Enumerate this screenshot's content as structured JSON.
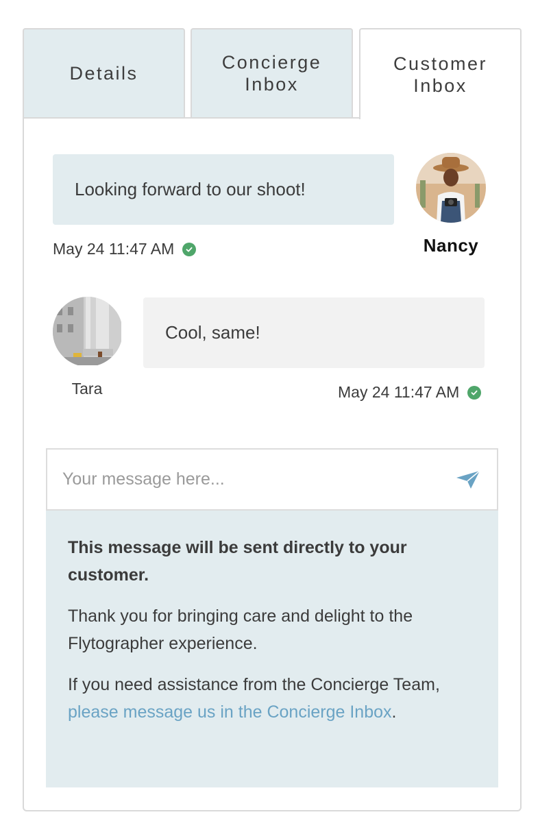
{
  "tabs": {
    "details": "Details",
    "concierge": "Concierge\nInbox",
    "customer": "Customer\nInbox",
    "active": "customer"
  },
  "messages": [
    {
      "sender": "Nancy",
      "text": "Looking forward to our shoot!",
      "timestamp": "May 24 11:47 AM",
      "status_icon": "check-circle-icon"
    },
    {
      "sender": "Tara",
      "text": "Cool, same!",
      "timestamp": "May 24 11:47 AM",
      "status_icon": "check-circle-icon"
    }
  ],
  "composer": {
    "placeholder": "Your message here...",
    "send_icon": "paper-plane-icon"
  },
  "notice": {
    "heading": "This message will be sent directly to your customer.",
    "body": "Thank you for bringing care and delight to the Flytographer experience.",
    "help_prefix": "If you need assistance from the Concierge Team, ",
    "help_link": "please message us in the Concierge Inbox",
    "help_suffix": "."
  },
  "colors": {
    "tab_inactive": "#e2ecef",
    "outgoing_bubble": "#e2ecef",
    "incoming_bubble": "#f2f2f2",
    "check": "#4fa66a",
    "link": "#6aa3c4",
    "send_icon": "#6aa3c4"
  }
}
